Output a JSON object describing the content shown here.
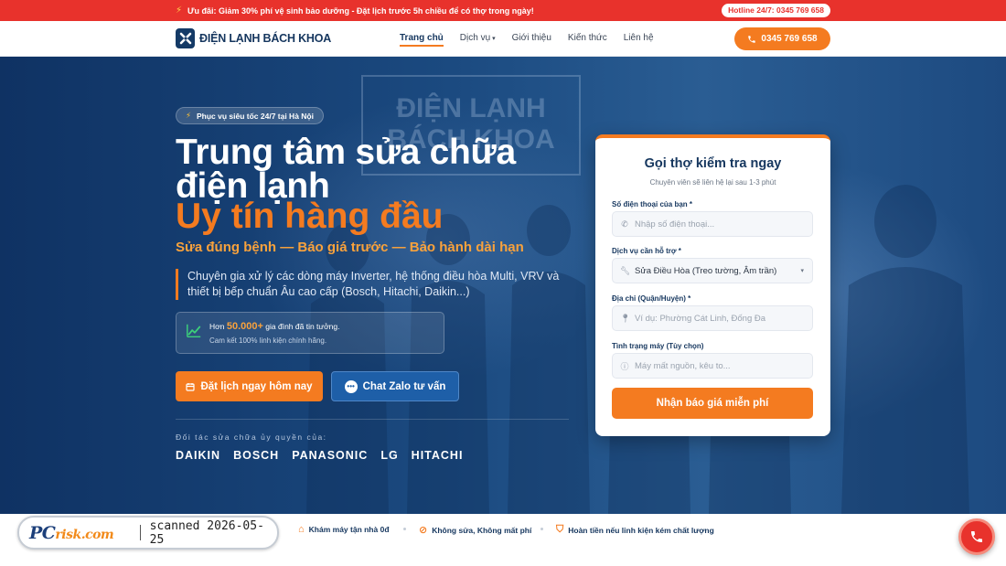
{
  "topbar": {
    "promo": "Ưu đãi: Giảm 30% phí vệ sinh bảo dưỡng - Đặt lịch trước 5h chiều để có thợ trong ngày!",
    "hotline": "Hotline 24/7: 0345 769 658"
  },
  "nav": {
    "logo_text": "ĐIỆN LẠNH BÁCH KHOA",
    "items": [
      "Trang chủ",
      "Dịch vụ",
      "Giới thiệu",
      "Kiến thức",
      "Liên hệ"
    ],
    "active": "Trang chủ",
    "phone": "0345 769 658"
  },
  "hero": {
    "badge": "Phục vụ siêu tốc 24/7 tại Hà Nội",
    "title": "Trung tâm sửa chữa điện lạnh",
    "title_accent": "Uy tín hàng đầu",
    "subtitle": "Sửa đúng bệnh — Báo giá trước — Bảo hành dài hạn",
    "description": "Chuyên gia xử lý các dòng máy Inverter, hệ thống điều hòa Multi, VRV và thiết bị bếp chuẩn Âu cao cấp (Bosch, Hitachi, Daikin...)",
    "trust_prefix": "Hơn",
    "trust_number": "50.000+",
    "trust_suffix": "gia đình đã tin tưởng.",
    "trust_line2": "Cam kết 100% linh kiện chính hãng.",
    "btn_book": "Đặt lịch ngay hôm nay",
    "btn_zalo": "Chat Zalo tư vấn",
    "partners_label": "Đối tác sửa chữa ủy quyền của:",
    "partners": [
      "DAIKIN",
      "BOSCH",
      "PANASONIC",
      "LG",
      "HITACHI"
    ],
    "wall_sign": "ĐIỆN LẠNH BÁCH KHOA"
  },
  "form": {
    "title": "Gọi thợ kiểm tra ngay",
    "subtitle": "Chuyên viên sẽ liên hệ lại sau 1-3 phút",
    "phone_label": "Số điện thoại của bạn *",
    "phone_placeholder": "Nhập số điện thoại...",
    "service_label": "Dịch vụ cần hỗ trợ *",
    "service_value": "Sửa Điều Hòa (Treo tường, Âm trần)",
    "address_label": "Địa chỉ (Quận/Huyện) *",
    "address_placeholder": "Ví dụ: Phường Cát Linh, Đống Đa",
    "status_label": "Tình trạng máy (Tùy chọn)",
    "status_placeholder": "Máy mất nguồn, kêu to...",
    "submit": "Nhận báo giá miễn phí"
  },
  "features": [
    "Khám máy tận nhà 0đ",
    "Không sửa, Không mất phí",
    "Hoàn tiền nếu linh kiện kém chất lượng"
  ],
  "watermark": {
    "logo_pc": "PC",
    "logo_risk": "risk.com",
    "text": "scanned 2026-05-25"
  },
  "colors": {
    "accent": "#f47b20",
    "topbar": "#e8322c",
    "navy": "#15365e"
  }
}
